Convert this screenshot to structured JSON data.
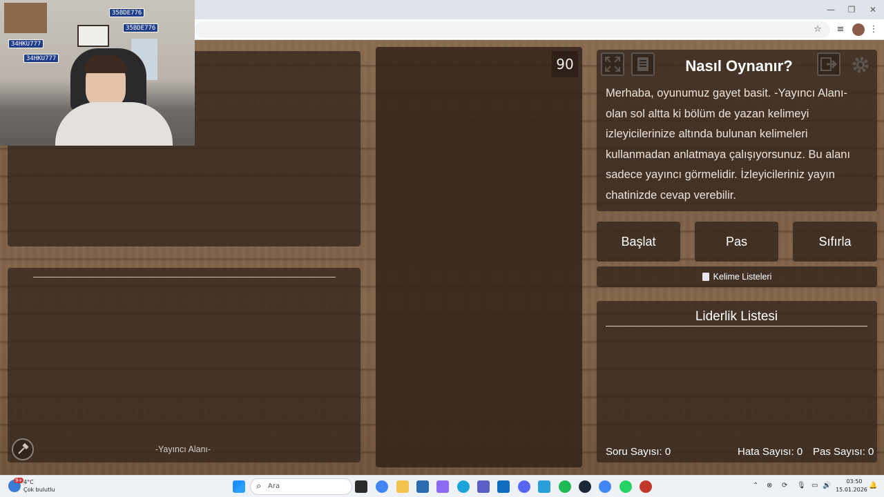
{
  "browser": {
    "window_controls": {
      "minimize": "—",
      "restore": "❐",
      "close": "✕"
    }
  },
  "game": {
    "timer": "90",
    "how_to_play": {
      "title": "Nasıl Oynanır?",
      "text": "Merhaba, oyunumuz gayet basit. -Yayıncı Alanı- olan sol altta ki bölüm de yazan kelimeyi izleyicilerinize altında bulunan kelimeleri kullanmadan anlatmaya çalışıyorsunuz. Bu alanı sadece yayıncı görmelidir. İzleyicileriniz yayın chatinizde cevap verebilir."
    },
    "buttons": {
      "start": "Başlat",
      "pass": "Pas",
      "reset": "Sıfırla"
    },
    "word_lists": "Kelime Listeleri",
    "leaderboard": {
      "title": "Liderlik Listesi"
    },
    "stats": {
      "questions": "Soru Sayısı: 0",
      "errors": "Hata Sayısı: 0",
      "passes": "Pas Sayısı: 0"
    },
    "streamer_area_label": "-Yayıncı Alanı-"
  },
  "webcam": {
    "plates": [
      "35BDE776",
      "35BDE776",
      "34HKU777",
      "34HKU777"
    ]
  },
  "taskbar": {
    "weather": {
      "temp": "4°C",
      "desc": "Çok bulutlu",
      "badge": "9+"
    },
    "search_placeholder": "Ara",
    "clock": {
      "time": "03:50",
      "date": "15.01.2026"
    }
  },
  "colors": {
    "wood": "#7a5d44",
    "panel": "#37281e",
    "text": "#ffffff"
  }
}
